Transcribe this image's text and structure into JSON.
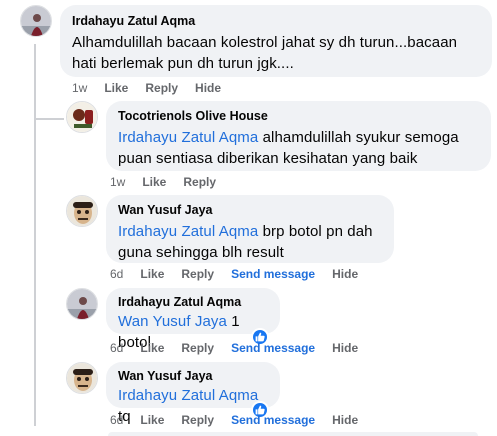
{
  "comments": [
    {
      "author": "Irdahayu Zatul Aqma",
      "text": "Alhamdulillah bacaan kolestrol jahat sy dh turun...bacaan hati berlemak pun dh turun jgk....",
      "time": "1w",
      "actions": [
        "Like",
        "Reply",
        "Hide"
      ]
    },
    {
      "author": "Tocotrienols Olive House",
      "mention": "Irdahayu Zatul Aqma",
      "text": " alhamdulillah syukur semoga puan sentiasa diberikan kesihatan yang baik",
      "time": "1w",
      "actions": [
        "Like",
        "Reply"
      ]
    },
    {
      "author": "Wan Yusuf Jaya",
      "mention": "Irdahayu Zatul Aqma",
      "text": " brp botol pn dah guna sehingga blh result",
      "time": "6d",
      "actions": [
        "Like",
        "Reply",
        "Send message",
        "Hide"
      ]
    },
    {
      "author": "Irdahayu Zatul Aqma",
      "mention": "Wan Yusuf Jaya",
      "text": " 1 botol",
      "time": "6d",
      "actions": [
        "Like",
        "Reply",
        "Send message",
        "Hide"
      ]
    },
    {
      "author": "Wan Yusuf Jaya",
      "mention": "Irdahayu Zatul Aqma",
      "text": " tq",
      "time": "6d",
      "actions": [
        "Like",
        "Reply",
        "Send message",
        "Hide"
      ]
    }
  ],
  "icons": {
    "like_badge": "thumbs-up-icon",
    "like_badge_color": "#1877f2"
  },
  "colors": {
    "mention": "#216fdb",
    "bubble": "#f0f2f5",
    "meta": "#65676b"
  }
}
